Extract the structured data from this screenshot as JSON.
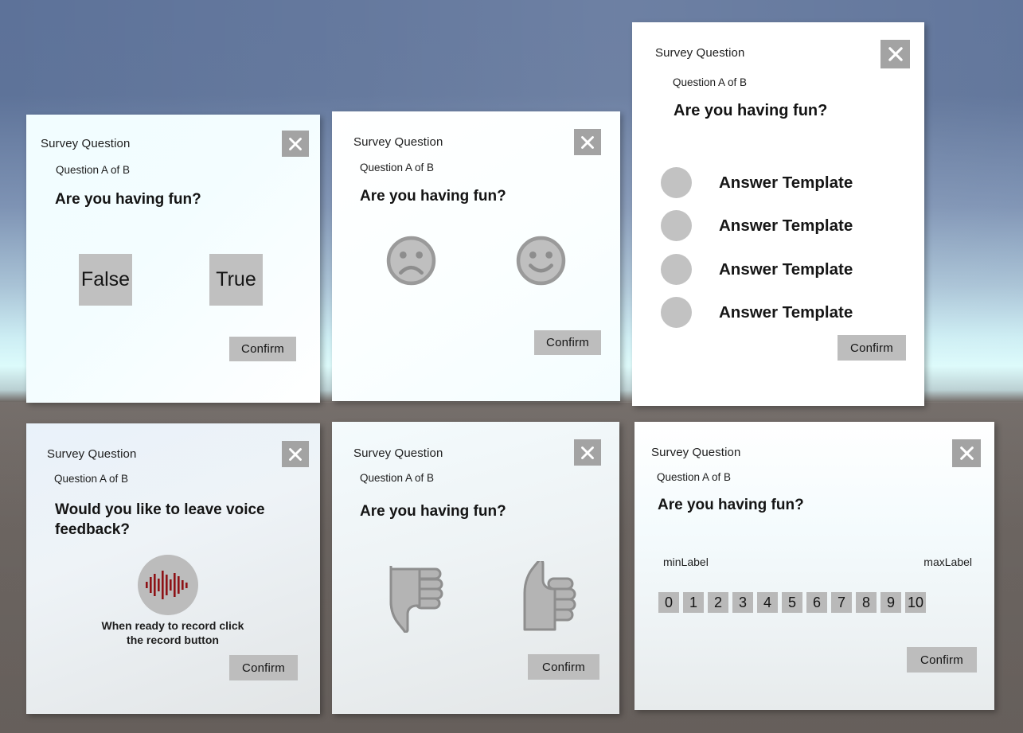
{
  "background": {
    "sky_color": "#5d7299",
    "horizon_color": "#dcfbfb",
    "ground_color": "#6b6460"
  },
  "common": {
    "survey_title": "Survey Question",
    "question_counter": "Question A of B",
    "confirm_label": "Confirm",
    "close_icon": "close-icon",
    "question_default": "Are you having fun?"
  },
  "cards": [
    {
      "id": "true-false-card",
      "title": "Survey Question",
      "counter": "Question A of B",
      "question": "Are you having fun?",
      "type": "boolean",
      "options": [
        {
          "label": "False",
          "value": "false"
        },
        {
          "label": "True",
          "value": "true"
        }
      ],
      "confirm": "Confirm"
    },
    {
      "id": "smiley-card",
      "title": "Survey Question",
      "counter": "Question A of B",
      "question": "Are you having fun?",
      "type": "smiley",
      "options": [
        {
          "label": "sad-face-icon",
          "value": "negative"
        },
        {
          "label": "happy-face-icon",
          "value": "positive"
        }
      ],
      "confirm": "Confirm"
    },
    {
      "id": "multiple-choice-card",
      "title": "Survey Question",
      "counter": "Question A of B",
      "question": "Are you having fun?",
      "type": "multiple-choice",
      "options": [
        {
          "label": "Answer Template",
          "value": "option-1"
        },
        {
          "label": "Answer Template",
          "value": "option-2"
        },
        {
          "label": "Answer Template",
          "value": "option-3"
        },
        {
          "label": "Answer Template",
          "value": "option-4"
        }
      ],
      "confirm": "Confirm"
    },
    {
      "id": "voice-feedback-card",
      "title": "Survey Question",
      "counter": "Question A of B",
      "question": "Would you like to leave voice feedback?",
      "type": "voice",
      "record_icon": "audio-waveform-icon",
      "record_hint_line1": "When ready to record click",
      "record_hint_line2": "the record button",
      "confirm": "Confirm"
    },
    {
      "id": "thumbs-card",
      "title": "Survey Question",
      "counter": "Question A of B",
      "question": "Are you having fun?",
      "type": "thumbs",
      "options": [
        {
          "label": "thumbs-down-icon",
          "value": "negative"
        },
        {
          "label": "thumbs-up-icon",
          "value": "positive"
        }
      ],
      "confirm": "Confirm"
    },
    {
      "id": "rating-scale-card",
      "title": "Survey Question",
      "counter": "Question A of B",
      "question": "Are you having fun?",
      "type": "scale",
      "min_label": "minLabel",
      "max_label": "maxLabel",
      "scale_values": [
        "0",
        "1",
        "2",
        "3",
        "4",
        "5",
        "6",
        "7",
        "8",
        "9",
        "10"
      ],
      "confirm": "Confirm"
    }
  ],
  "colors": {
    "button_gray": "#bdbdbd",
    "close_gray": "#a3a3a3",
    "bullet_gray": "#c2c2c2",
    "waveform_red": "#8e1216",
    "face_gray": "#adadad"
  }
}
